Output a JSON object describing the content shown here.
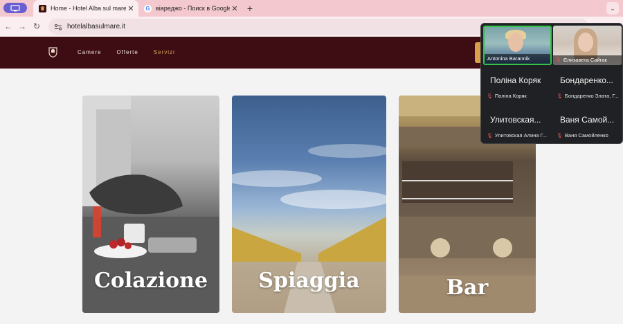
{
  "browser": {
    "tabs": [
      {
        "title": "Home - Hotel Alba sul mare",
        "favicon": "hotel-crest-icon",
        "active": true
      },
      {
        "title": "віареджо - Поиск в Google",
        "favicon": "google-icon",
        "active": false
      }
    ],
    "close_glyph": "✕",
    "new_tab_glyph": "+",
    "tab_search_glyph": "⌄",
    "url": "hotelalbasulmare.it",
    "nav_glyphs": {
      "back": "←",
      "forward": "→",
      "reload": "↻"
    }
  },
  "site": {
    "nav": [
      {
        "label": "Camere",
        "current": false
      },
      {
        "label": "Offerte",
        "current": false
      },
      {
        "label": "Servizi",
        "current": true
      }
    ],
    "accent_color": "#d9a85a",
    "header_color": "#3e0d14",
    "cards": [
      {
        "title": "Colazione"
      },
      {
        "title": "Spiaggia"
      },
      {
        "title": "Bar"
      }
    ]
  },
  "meeting": {
    "video_tiles": [
      {
        "name": "Antonina Barannik",
        "muted": false
      },
      {
        "name": "Єлизавета Сайгак",
        "muted": true
      }
    ],
    "participants": [
      {
        "display": "Поліна Коряк",
        "name": "Поліна Коряк",
        "muted": true
      },
      {
        "display": "Бондаренко...",
        "name": "Бондаренко Злата, Г...",
        "muted": true
      },
      {
        "display": "Улитовская...",
        "name": "Улитовская Алина Г...",
        "muted": true
      },
      {
        "display": "Ваня Самой...",
        "name": "Ваня Самойленко",
        "muted": true
      }
    ]
  }
}
